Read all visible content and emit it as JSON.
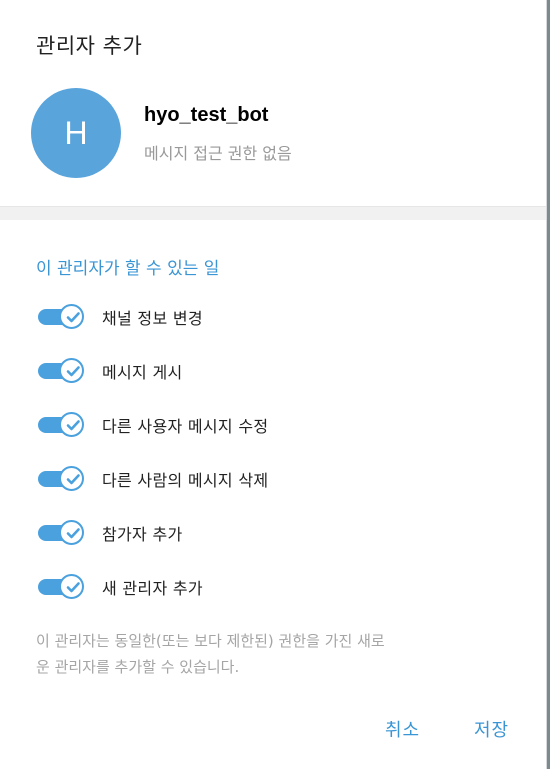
{
  "dialog": {
    "title": "관리자 추가"
  },
  "bot": {
    "avatar_letter": "H",
    "avatar_color": "#5aa4dc",
    "name": "hyo_test_bot",
    "status": "메시지 접근 권한 없음"
  },
  "permissions": {
    "section_title": "이 관리자가 할 수 있는 일",
    "items": [
      {
        "label": "채널 정보 변경",
        "enabled": true
      },
      {
        "label": "메시지 게시",
        "enabled": true
      },
      {
        "label": "다른 사용자 메시지 수정",
        "enabled": true
      },
      {
        "label": "다른 사람의 메시지 삭제",
        "enabled": true
      },
      {
        "label": "참가자 추가",
        "enabled": true
      },
      {
        "label": "새 관리자 추가",
        "enabled": true
      }
    ],
    "hint_line1": "이 관리자는 동일한(또는 보다 제한된) 권한을 가진 새로",
    "hint_line2": "운 관리자를 추가할 수 있습니다."
  },
  "actions": {
    "cancel_label": "취소",
    "save_label": "저장"
  },
  "colors": {
    "accent": "#3a95d4",
    "toggle_on": "#4ba1de"
  }
}
